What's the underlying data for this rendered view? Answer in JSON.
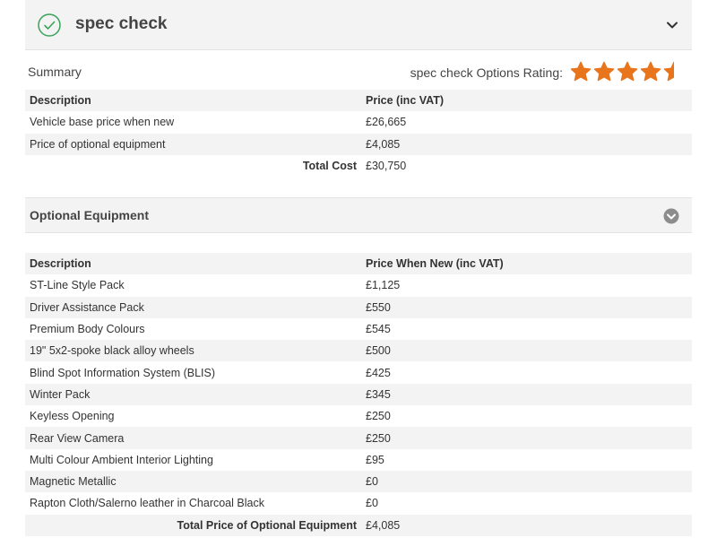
{
  "panel": {
    "title": "spec check"
  },
  "summary": {
    "label": "Summary",
    "rating_label": "spec check Options Rating:",
    "rating_value": 4.5,
    "rating_max": 5,
    "rating_color": "#e8741c",
    "headers": {
      "description": "Description",
      "price": "Price (inc VAT)"
    },
    "rows": [
      {
        "description": "Vehicle base price when new",
        "price": "£26,665"
      },
      {
        "description": "Price of optional equipment",
        "price": "£4,085"
      }
    ],
    "total_label": "Total Cost",
    "total_value": "£30,750"
  },
  "optional": {
    "title": "Optional Equipment",
    "headers": {
      "description": "Description",
      "price": "Price When New (inc VAT)"
    },
    "rows": [
      {
        "description": "ST-Line Style Pack",
        "price": "£1,125"
      },
      {
        "description": "Driver Assistance Pack",
        "price": "£550"
      },
      {
        "description": "Premium Body Colours",
        "price": "£545"
      },
      {
        "description": "19\" 5x2-spoke black alloy wheels",
        "price": "£500"
      },
      {
        "description": "Blind Spot Information System (BLIS)",
        "price": "£425"
      },
      {
        "description": "Winter Pack",
        "price": "£345"
      },
      {
        "description": "Keyless Opening",
        "price": "£250"
      },
      {
        "description": "Rear View Camera",
        "price": "£250"
      },
      {
        "description": "Multi Colour Ambient Interior Lighting",
        "price": "£95"
      },
      {
        "description": "Magnetic Metallic",
        "price": "£0"
      },
      {
        "description": "Rapton Cloth/Salerno leather in Charcoal Black",
        "price": "£0"
      }
    ],
    "total_label": "Total Price of Optional Equipment",
    "total_value": "£4,085"
  },
  "colors": {
    "accent_green": "#3aa35b",
    "star_orange": "#e8741c",
    "chevron_grey": "#8c8c8c"
  }
}
